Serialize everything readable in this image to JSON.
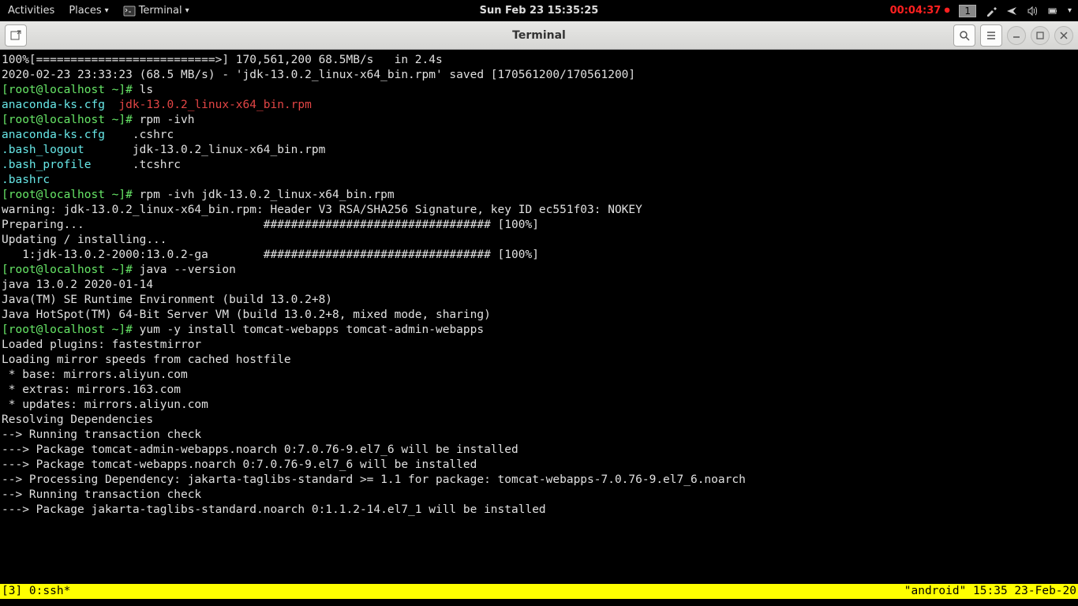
{
  "topbar": {
    "activities": "Activities",
    "places": "Places",
    "app_name": "Terminal",
    "clock": "Sun Feb 23  15:35:25",
    "timer": "00:04:37",
    "workspace": "1"
  },
  "titlebar": {
    "title": "Terminal"
  },
  "terminal": {
    "lines": [
      {
        "segments": [
          {
            "cls": "white",
            "t": "100%[==========================>] 170,561,200 68.5MB/s   in 2.4s"
          }
        ]
      },
      {
        "segments": [
          {
            "cls": "white",
            "t": ""
          }
        ]
      },
      {
        "segments": [
          {
            "cls": "white",
            "t": "2020-02-23 23:33:23 (68.5 MB/s) - 'jdk-13.0.2_linux-x64_bin.rpm' saved [170561200/170561200]"
          }
        ]
      },
      {
        "segments": [
          {
            "cls": "white",
            "t": ""
          }
        ]
      },
      {
        "segments": [
          {
            "cls": "green",
            "t": "[root@localhost ~]# "
          },
          {
            "cls": "white",
            "t": "ls"
          }
        ]
      },
      {
        "segments": [
          {
            "cls": "cyan",
            "t": "anaconda-ks.cfg  "
          },
          {
            "cls": "red",
            "t": "jdk-13.0.2_linux-x64_bin.rpm"
          }
        ]
      },
      {
        "segments": [
          {
            "cls": "green",
            "t": "[root@localhost ~]# "
          },
          {
            "cls": "white",
            "t": "rpm -ivh"
          }
        ]
      },
      {
        "segments": [
          {
            "cls": "cyan",
            "t": "anaconda-ks.cfg    "
          },
          {
            "cls": "white",
            "t": ".cshrc"
          }
        ]
      },
      {
        "segments": [
          {
            "cls": "cyan",
            "t": ".bash_logout       "
          },
          {
            "cls": "white",
            "t": "jdk-13.0.2_linux-x64_bin.rpm"
          }
        ]
      },
      {
        "segments": [
          {
            "cls": "cyan",
            "t": ".bash_profile      "
          },
          {
            "cls": "white",
            "t": ".tcshrc"
          }
        ]
      },
      {
        "segments": [
          {
            "cls": "cyan",
            "t": ".bashrc"
          }
        ]
      },
      {
        "segments": [
          {
            "cls": "green",
            "t": "[root@localhost ~]# "
          },
          {
            "cls": "white",
            "t": "rpm -ivh jdk-13.0.2_linux-x64_bin.rpm"
          }
        ]
      },
      {
        "segments": [
          {
            "cls": "white",
            "t": "warning: jdk-13.0.2_linux-x64_bin.rpm: Header V3 RSA/SHA256 Signature, key ID ec551f03: NOKEY"
          }
        ]
      },
      {
        "segments": [
          {
            "cls": "white",
            "t": "Preparing...                          ################################# [100%]"
          }
        ]
      },
      {
        "segments": [
          {
            "cls": "white",
            "t": "Updating / installing..."
          }
        ]
      },
      {
        "segments": [
          {
            "cls": "white",
            "t": "   1:jdk-13.0.2-2000:13.0.2-ga        ################################# [100%]"
          }
        ]
      },
      {
        "segments": [
          {
            "cls": "green",
            "t": "[root@localhost ~]# "
          },
          {
            "cls": "white",
            "t": "java --version"
          }
        ]
      },
      {
        "segments": [
          {
            "cls": "white",
            "t": "java 13.0.2 2020-01-14"
          }
        ]
      },
      {
        "segments": [
          {
            "cls": "white",
            "t": "Java(TM) SE Runtime Environment (build 13.0.2+8)"
          }
        ]
      },
      {
        "segments": [
          {
            "cls": "white",
            "t": "Java HotSpot(TM) 64-Bit Server VM (build 13.0.2+8, mixed mode, sharing)"
          }
        ]
      },
      {
        "segments": [
          {
            "cls": "green",
            "t": "[root@localhost ~]# "
          },
          {
            "cls": "white",
            "t": "yum -y install tomcat-webapps tomcat-admin-webapps"
          }
        ]
      },
      {
        "segments": [
          {
            "cls": "white",
            "t": "Loaded plugins: fastestmirror"
          }
        ]
      },
      {
        "segments": [
          {
            "cls": "white",
            "t": "Loading mirror speeds from cached hostfile"
          }
        ]
      },
      {
        "segments": [
          {
            "cls": "white",
            "t": " * base: mirrors.aliyun.com"
          }
        ]
      },
      {
        "segments": [
          {
            "cls": "white",
            "t": " * extras: mirrors.163.com"
          }
        ]
      },
      {
        "segments": [
          {
            "cls": "white",
            "t": " * updates: mirrors.aliyun.com"
          }
        ]
      },
      {
        "segments": [
          {
            "cls": "white",
            "t": "Resolving Dependencies"
          }
        ]
      },
      {
        "segments": [
          {
            "cls": "white",
            "t": "--> Running transaction check"
          }
        ]
      },
      {
        "segments": [
          {
            "cls": "white",
            "t": "---> Package tomcat-admin-webapps.noarch 0:7.0.76-9.el7_6 will be installed"
          }
        ]
      },
      {
        "segments": [
          {
            "cls": "white",
            "t": "---> Package tomcat-webapps.noarch 0:7.0.76-9.el7_6 will be installed"
          }
        ]
      },
      {
        "segments": [
          {
            "cls": "white",
            "t": "--> Processing Dependency: jakarta-taglibs-standard >= 1.1 for package: tomcat-webapps-7.0.76-9.el7_6.noarch"
          }
        ]
      },
      {
        "segments": [
          {
            "cls": "white",
            "t": "--> Running transaction check"
          }
        ]
      },
      {
        "segments": [
          {
            "cls": "white",
            "t": "---> Package jakarta-taglibs-standard.noarch 0:1.1.2-14.el7_1 will be installed"
          }
        ]
      }
    ]
  },
  "statusbar": {
    "left": "[3] 0:ssh*",
    "right": "\"android\" 15:35 23-Feb-20"
  }
}
